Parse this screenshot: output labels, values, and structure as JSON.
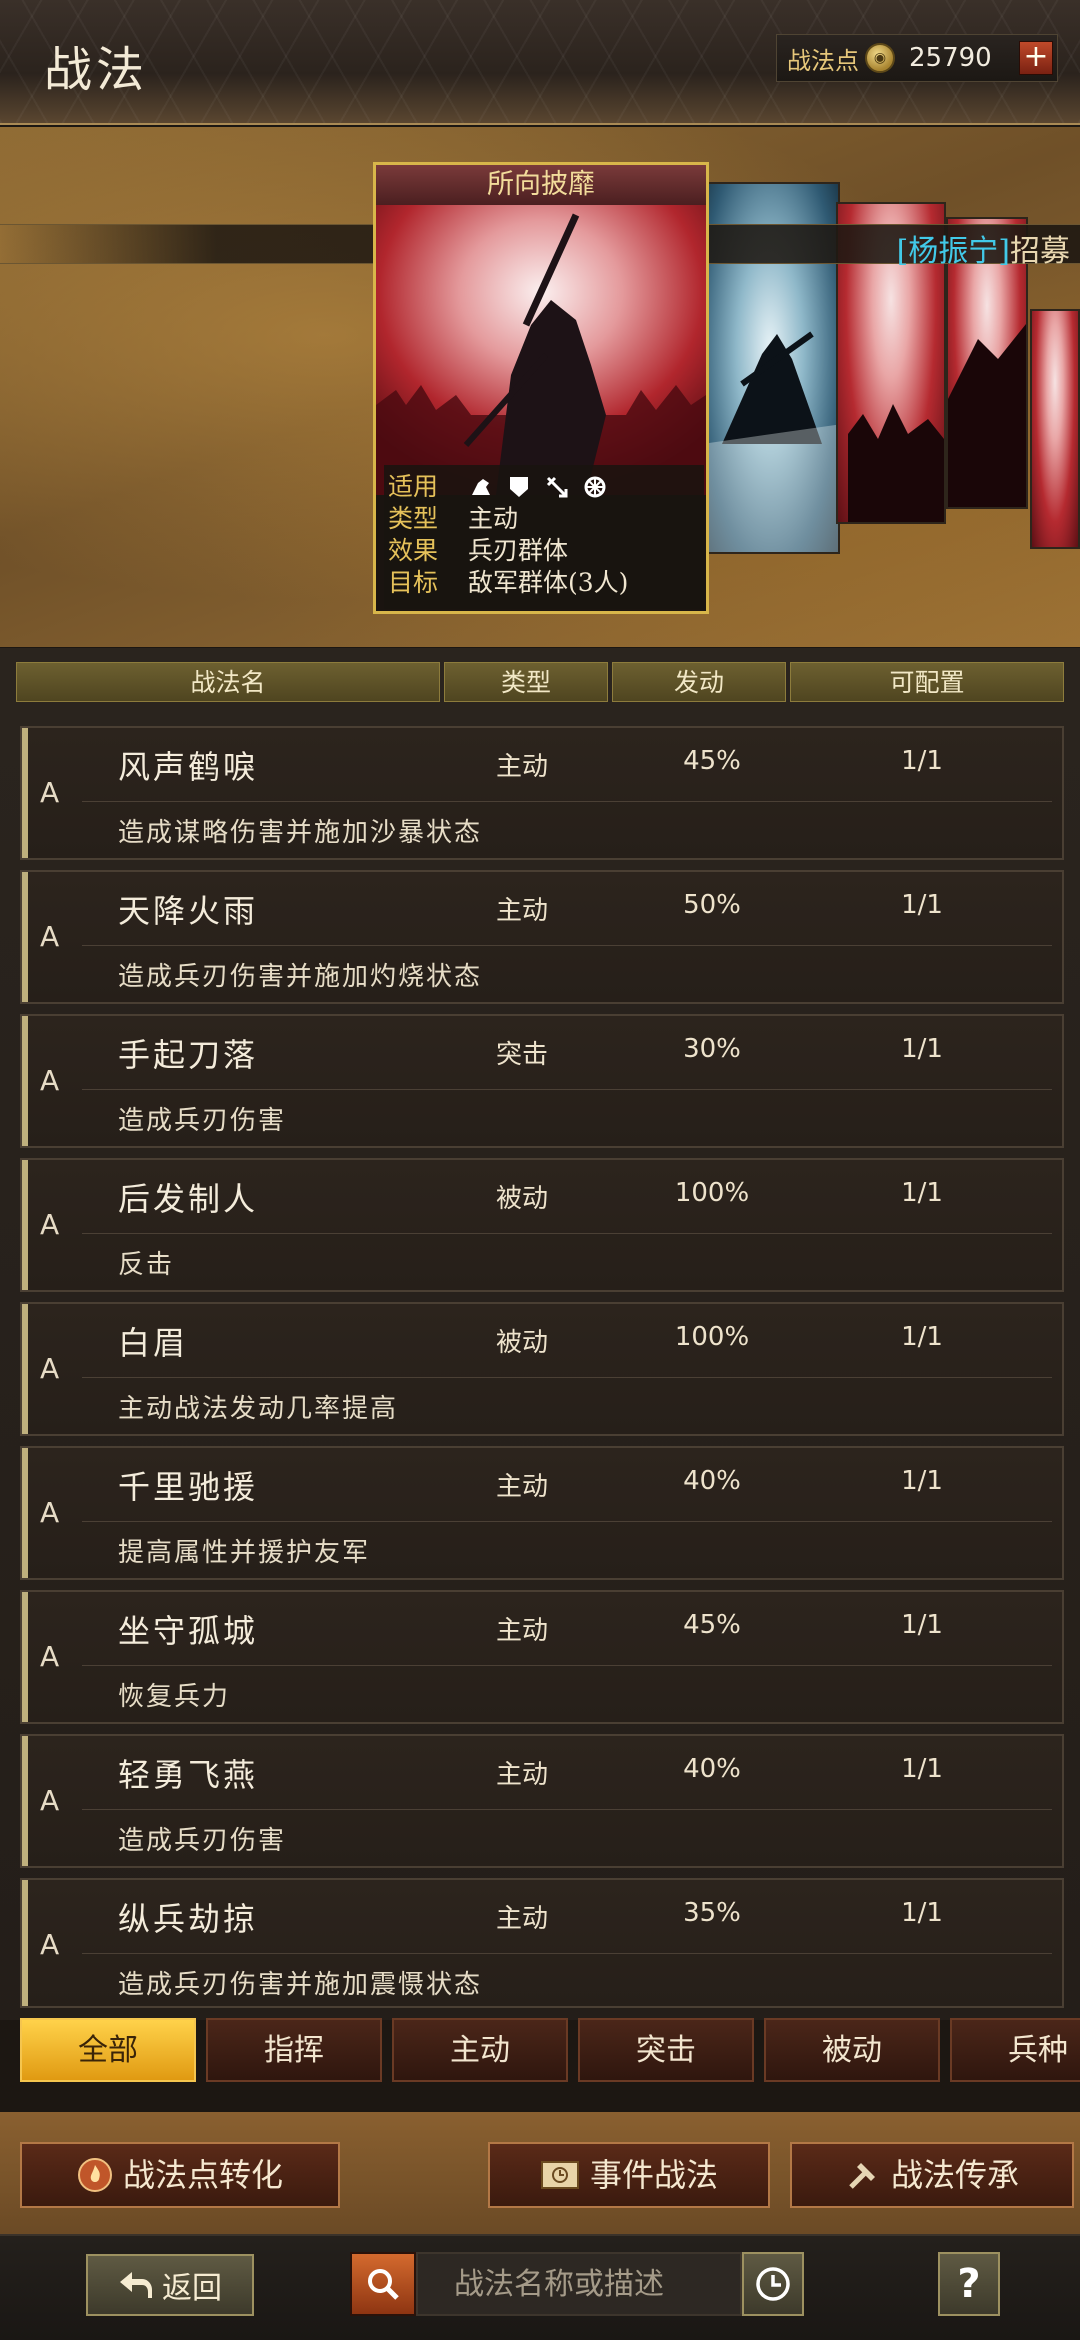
{
  "header": {
    "title": "战法",
    "points_label": "战法点",
    "points_value": "25790"
  },
  "banner": {
    "recruit_name": "[杨振宁]",
    "recruit_suffix": "招募",
    "card": {
      "title": "所向披靡",
      "rows": [
        {
          "key": "适用",
          "value": ""
        },
        {
          "key": "类型",
          "value": "主动"
        },
        {
          "key": "效果",
          "value": "兵刃群体"
        },
        {
          "key": "目标",
          "value": "敌军群体(3人)"
        }
      ]
    }
  },
  "columns": [
    "战法名",
    "类型",
    "发动",
    "可配置"
  ],
  "tactics": [
    {
      "grade": "A",
      "name": "风声鹤唳",
      "type": "主动",
      "rate": "45%",
      "conf": "1/1",
      "desc": "造成谋略伤害并施加沙暴状态"
    },
    {
      "grade": "A",
      "name": "天降火雨",
      "type": "主动",
      "rate": "50%",
      "conf": "1/1",
      "desc": "造成兵刃伤害并施加灼烧状态"
    },
    {
      "grade": "A",
      "name": "手起刀落",
      "type": "突击",
      "rate": "30%",
      "conf": "1/1",
      "desc": "造成兵刃伤害"
    },
    {
      "grade": "A",
      "name": "后发制人",
      "type": "被动",
      "rate": "100%",
      "conf": "1/1",
      "desc": "反击"
    },
    {
      "grade": "A",
      "name": "白眉",
      "type": "被动",
      "rate": "100%",
      "conf": "1/1",
      "desc": "主动战法发动几率提高"
    },
    {
      "grade": "A",
      "name": "千里驰援",
      "type": "主动",
      "rate": "40%",
      "conf": "1/1",
      "desc": "提高属性并援护友军"
    },
    {
      "grade": "A",
      "name": "坐守孤城",
      "type": "主动",
      "rate": "45%",
      "conf": "1/1",
      "desc": "恢复兵力"
    },
    {
      "grade": "A",
      "name": "轻勇飞燕",
      "type": "主动",
      "rate": "40%",
      "conf": "1/1",
      "desc": "造成兵刃伤害"
    },
    {
      "grade": "A",
      "name": "纵兵劫掠",
      "type": "主动",
      "rate": "35%",
      "conf": "1/1",
      "desc": "造成兵刃伤害并施加震慑状态"
    }
  ],
  "tabs": [
    "全部",
    "指挥",
    "主动",
    "突击",
    "被动",
    "兵种"
  ],
  "actions": {
    "convert": "战法点转化",
    "event": "事件战法",
    "inherit": "战法传承"
  },
  "footer": {
    "back": "返回",
    "search_placeholder": "战法名称或描述",
    "help": "?"
  }
}
